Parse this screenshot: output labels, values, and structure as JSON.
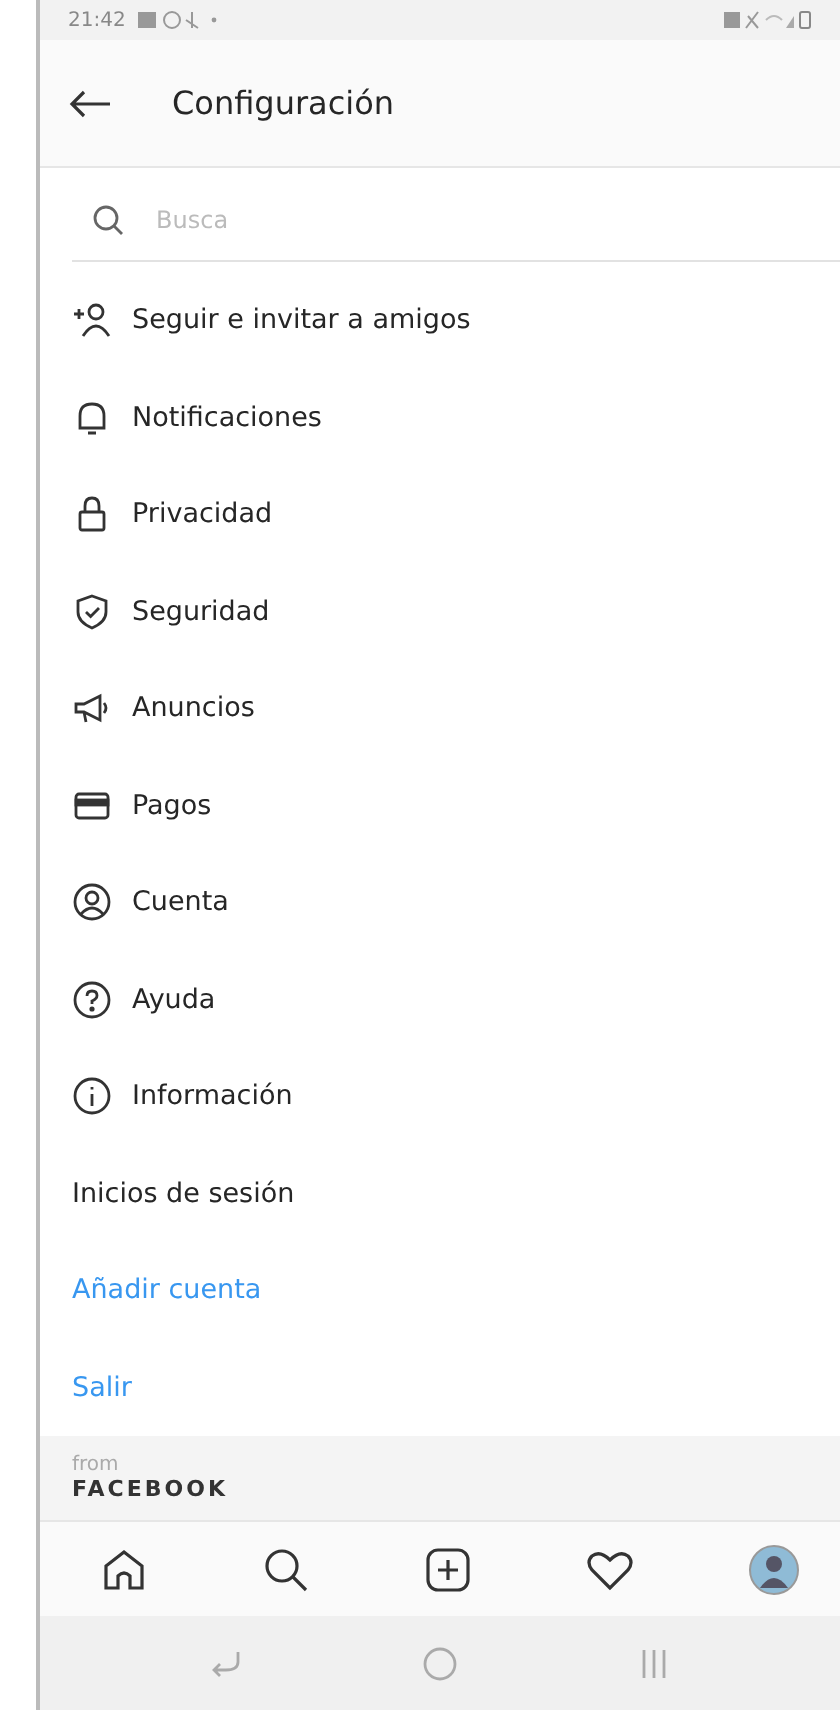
{
  "status_bar": {
    "time": "21:42"
  },
  "header": {
    "title": "Configuración"
  },
  "search": {
    "placeholder": "Busca"
  },
  "menu": [
    {
      "label": "Seguir e invitar a amigos",
      "kind": "icon"
    },
    {
      "label": "Notificaciones",
      "kind": "icon"
    },
    {
      "label": "Privacidad",
      "kind": "icon"
    },
    {
      "label": "Seguridad",
      "kind": "icon"
    },
    {
      "label": "Anuncios",
      "kind": "icon"
    },
    {
      "label": "Pagos",
      "kind": "icon"
    },
    {
      "label": "Cuenta",
      "kind": "icon"
    },
    {
      "label": "Ayuda",
      "kind": "icon"
    },
    {
      "label": "Información",
      "kind": "icon"
    },
    {
      "label": "Inicios de sesión",
      "kind": "plain"
    },
    {
      "label": "Añadir cuenta",
      "kind": "link"
    },
    {
      "label": "Salir",
      "kind": "link"
    }
  ],
  "footer": {
    "from": "from",
    "brand": "FACEBOOK"
  }
}
